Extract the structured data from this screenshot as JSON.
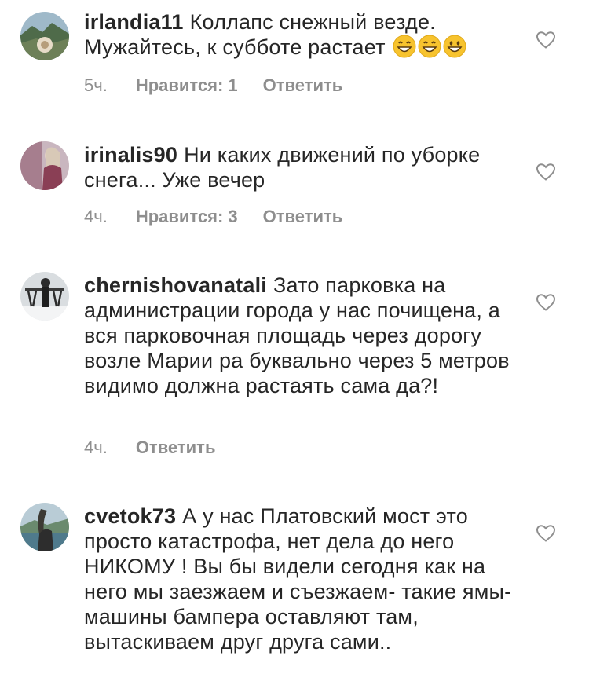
{
  "comments": [
    {
      "username": "irlandia11",
      "text": "Коллапс снежный везде. Мужайтесь, к субботе растает",
      "emojis": [
        "grinning-face-with-smiling-eyes",
        "grinning-face-with-smiling-eyes",
        "grinning-face"
      ],
      "time": "5ч.",
      "likes": "Нравится: 1",
      "reply": "Ответить"
    },
    {
      "username": "irinalis90",
      "text": "Ни каких движений по уборке снега... Уже вечер",
      "time": "4ч.",
      "likes": "Нравится: 3",
      "reply": "Ответить"
    },
    {
      "username": "chernishovanatali",
      "text": "Зато парковка на администрации города у нас почищена, а вся парковочная площадь через дорогу возле Марии ра буквально через 5 метров видимо должна растаять сама да?!",
      "time": "4ч.",
      "reply": "Ответить"
    },
    {
      "username": "cvetok73",
      "text": "А у нас Платовский мост это просто катастрофа, нет дела до него НИКОМУ ! Вы бы видели сегодня как на него мы заезжаем и съезжаем- такие ямы- машины бампера оставляют там, вытаскиваем друг друга сами.."
    }
  ],
  "colors": {
    "text": "#262626",
    "meta": "#8e8e8e",
    "heart": "#8e8e8e"
  }
}
